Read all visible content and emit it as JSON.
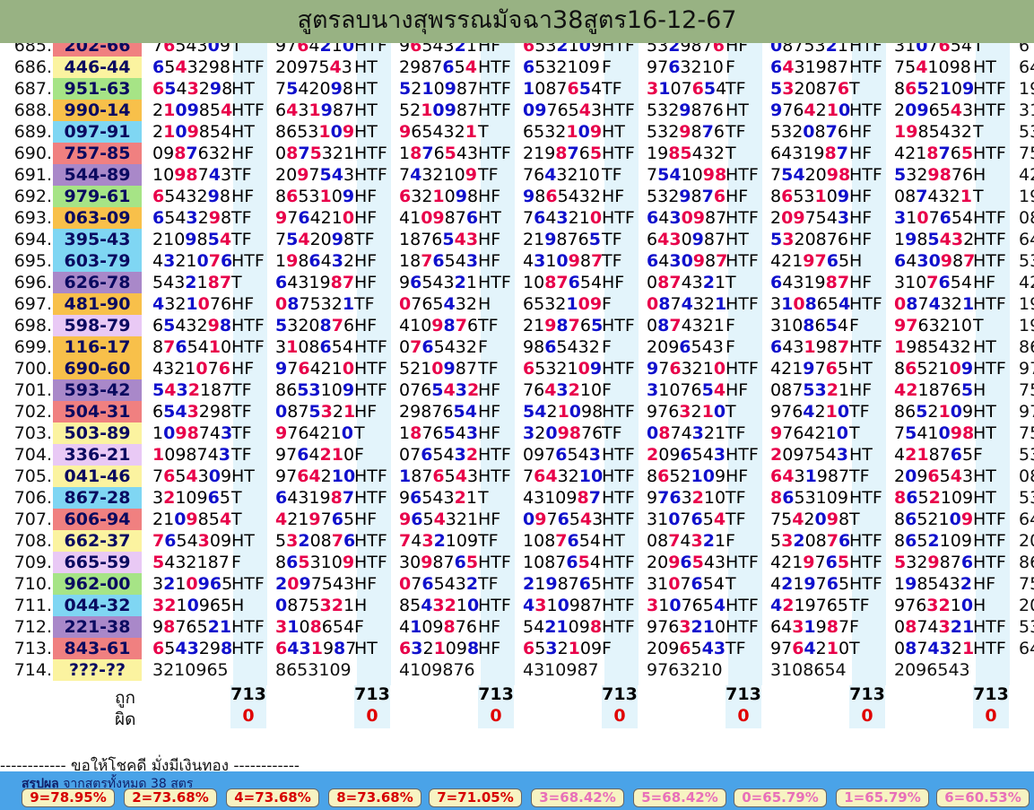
{
  "title": "สูตรลบนางสุพรรณมัจฉา38สูตร16-12-67",
  "colors": {
    "header_bg": "#98b283",
    "cell_bg": "#e3f4fb",
    "digit_blue": "#1010cc",
    "digit_red": "#e8004a",
    "summary_bg": "#4aa3e8",
    "pill_bg": "#f7f3c2",
    "result_colors": [
      "#f08080",
      "#fbf3a0",
      "#a6e486",
      "#f8c04a",
      "#7fd6f3",
      "#a988c9",
      "#e9c9f5"
    ]
  },
  "rows": [
    {
      "n": "685.",
      "r": "202-66",
      "c": 0,
      "cols": [
        [
          "7654309",
          "T"
        ],
        [
          "9764210",
          "HTF"
        ],
        [
          "9654321",
          "HF"
        ],
        [
          "6532109",
          "HTF"
        ],
        [
          "5329876",
          "HF"
        ],
        [
          "0875321",
          "HTF"
        ],
        [
          "3107654",
          "T"
        ],
        [
          "6"
        ]
      ]
    },
    {
      "n": "686.",
      "r": "446-44",
      "c": 1,
      "cols": [
        [
          "6543298",
          "HTF"
        ],
        [
          "2097543",
          "HT"
        ],
        [
          "2987654",
          "HTF"
        ],
        [
          "6532109",
          "F"
        ],
        [
          "9763210",
          "F"
        ],
        [
          "6431987",
          "HTF"
        ],
        [
          "7541098",
          "HT"
        ],
        [
          "64"
        ]
      ]
    },
    {
      "n": "687.",
      "r": "951-63",
      "c": 2,
      "cols": [
        [
          "6543298",
          "HT"
        ],
        [
          "7542098",
          "HT"
        ],
        [
          "5210987",
          "HTF"
        ],
        [
          "1087654",
          "TF"
        ],
        [
          "3107654",
          "TF"
        ],
        [
          "5320876",
          "T"
        ],
        [
          "8652109",
          "HTF"
        ],
        [
          "19"
        ]
      ]
    },
    {
      "n": "688.",
      "r": "990-14",
      "c": 3,
      "cols": [
        [
          "2109854",
          "HTF"
        ],
        [
          "6431987",
          "HT"
        ],
        [
          "5210987",
          "HTF"
        ],
        [
          "0976543",
          "HTF"
        ],
        [
          "5329876",
          "HT"
        ],
        [
          "9764210",
          "HTF"
        ],
        [
          "2096543",
          "HTF"
        ],
        [
          "31"
        ]
      ]
    },
    {
      "n": "689.",
      "r": "097-91",
      "c": 4,
      "cols": [
        [
          "2109854",
          "HT"
        ],
        [
          "8653109",
          "HT"
        ],
        [
          "9654321",
          "T"
        ],
        [
          "6532109",
          "HT"
        ],
        [
          "5329876",
          "TF"
        ],
        [
          "5320876",
          "HF"
        ],
        [
          "1985432",
          "T"
        ],
        [
          "53"
        ]
      ]
    },
    {
      "n": "690.",
      "r": "757-85",
      "c": 0,
      "cols": [
        [
          "0987632",
          "HF"
        ],
        [
          "0875321",
          "HTF"
        ],
        [
          "1876543",
          "HTF"
        ],
        [
          "2198765",
          "HTF"
        ],
        [
          "1985432",
          "T"
        ],
        [
          "6431987",
          "HF"
        ],
        [
          "4218765",
          "HTF"
        ],
        [
          "75"
        ]
      ]
    },
    {
      "n": "691.",
      "r": "544-89",
      "c": 5,
      "cols": [
        [
          "1098743",
          "TF"
        ],
        [
          "2097543",
          "HTF"
        ],
        [
          "7432109",
          "TF"
        ],
        [
          "7643210",
          "TF"
        ],
        [
          "7541098",
          "HTF"
        ],
        [
          "7542098",
          "HTF"
        ],
        [
          "5329876",
          "H"
        ],
        [
          "42"
        ]
      ]
    },
    {
      "n": "692.",
      "r": "979-61",
      "c": 2,
      "cols": [
        [
          "6543298",
          "HF"
        ],
        [
          "8653109",
          "HF"
        ],
        [
          "6321098",
          "HF"
        ],
        [
          "9865432",
          "HF"
        ],
        [
          "5329876",
          "HF"
        ],
        [
          "8653109",
          "HF"
        ],
        [
          "0874321",
          "T"
        ],
        [
          "19"
        ]
      ]
    },
    {
      "n": "693.",
      "r": "063-09",
      "c": 3,
      "cols": [
        [
          "6543298",
          "TF"
        ],
        [
          "9764210",
          "HF"
        ],
        [
          "4109876",
          "HT"
        ],
        [
          "7643210",
          "HTF"
        ],
        [
          "6430987",
          "HTF"
        ],
        [
          "2097543",
          "HF"
        ],
        [
          "3107654",
          "HTF"
        ],
        [
          "08"
        ]
      ]
    },
    {
      "n": "694.",
      "r": "395-43",
      "c": 4,
      "cols": [
        [
          "2109854",
          "TF"
        ],
        [
          "7542098",
          "TF"
        ],
        [
          "1876543",
          "HF"
        ],
        [
          "2198765",
          "TF"
        ],
        [
          "6430987",
          "HT"
        ],
        [
          "5320876",
          "HF"
        ],
        [
          "1985432",
          "HTF"
        ],
        [
          "64"
        ]
      ]
    },
    {
      "n": "695.",
      "r": "603-79",
      "c": 4,
      "cols": [
        [
          "4321076",
          "HTF"
        ],
        [
          "1986432",
          "HF"
        ],
        [
          "1876543",
          "HF"
        ],
        [
          "4310987",
          "TF"
        ],
        [
          "6430987",
          "HTF"
        ],
        [
          "4219765",
          "H"
        ],
        [
          "6430987",
          "HTF"
        ],
        [
          "53"
        ]
      ]
    },
    {
      "n": "696.",
      "r": "626-78",
      "c": 5,
      "cols": [
        [
          "5432187",
          "T"
        ],
        [
          "6431987",
          "HF"
        ],
        [
          "9654321",
          "HTF"
        ],
        [
          "1087654",
          "HF"
        ],
        [
          "0874321",
          "T"
        ],
        [
          "6431987",
          "HF"
        ],
        [
          "3107654",
          "HF"
        ],
        [
          "42"
        ]
      ]
    },
    {
      "n": "697.",
      "r": "481-90",
      "c": 3,
      "cols": [
        [
          "4321076",
          "HF"
        ],
        [
          "0875321",
          "TF"
        ],
        [
          "0765432",
          "H"
        ],
        [
          "6532109",
          "F"
        ],
        [
          "0874321",
          "HTF"
        ],
        [
          "3108654",
          "HTF"
        ],
        [
          "0874321",
          "HTF"
        ],
        [
          "19"
        ]
      ]
    },
    {
      "n": "698.",
      "r": "598-79",
      "c": 6,
      "cols": [
        [
          "6543298",
          "HTF"
        ],
        [
          "5320876",
          "HF"
        ],
        [
          "4109876",
          "TF"
        ],
        [
          "2198765",
          "HTF"
        ],
        [
          "0874321",
          "F"
        ],
        [
          "3108654",
          "F"
        ],
        [
          "9763210",
          "T"
        ],
        [
          "19"
        ]
      ]
    },
    {
      "n": "699.",
      "r": "116-17",
      "c": 3,
      "cols": [
        [
          "8765410",
          "HTF"
        ],
        [
          "3108654",
          "HTF"
        ],
        [
          "0765432",
          "F"
        ],
        [
          "9865432",
          "F"
        ],
        [
          "2096543",
          "F"
        ],
        [
          "6431987",
          "HTF"
        ],
        [
          "1985432",
          "HT"
        ],
        [
          "86"
        ]
      ]
    },
    {
      "n": "700.",
      "r": "690-60",
      "c": 3,
      "cols": [
        [
          "4321076",
          "HF"
        ],
        [
          "9764210",
          "HTF"
        ],
        [
          "5210987",
          "TF"
        ],
        [
          "6532109",
          "HTF"
        ],
        [
          "9763210",
          "HTF"
        ],
        [
          "4219765",
          "HT"
        ],
        [
          "8652109",
          "HTF"
        ],
        [
          "97"
        ]
      ]
    },
    {
      "n": "701.",
      "r": "593-42",
      "c": 5,
      "cols": [
        [
          "5432187",
          "TF"
        ],
        [
          "8653109",
          "HTF"
        ],
        [
          "0765432",
          "HF"
        ],
        [
          "7643210",
          "F"
        ],
        [
          "3107654",
          "HF"
        ],
        [
          "0875321",
          "HF"
        ],
        [
          "4218765",
          "H"
        ],
        [
          "75"
        ]
      ]
    },
    {
      "n": "702.",
      "r": "504-31",
      "c": 0,
      "cols": [
        [
          "6543298",
          "TF"
        ],
        [
          "0875321",
          "HF"
        ],
        [
          "2987654",
          "HF"
        ],
        [
          "5421098",
          "HTF"
        ],
        [
          "9763210",
          "T"
        ],
        [
          "9764210",
          "TF"
        ],
        [
          "8652109",
          "HT"
        ],
        [
          "97"
        ]
      ]
    },
    {
      "n": "703.",
      "r": "503-89",
      "c": 1,
      "cols": [
        [
          "1098743",
          "TF"
        ],
        [
          "9764210",
          "T"
        ],
        [
          "1876543",
          "HF"
        ],
        [
          "3209876",
          "TF"
        ],
        [
          "0874321",
          "TF"
        ],
        [
          "9764210",
          "T"
        ],
        [
          "7541098",
          "HT"
        ],
        [
          "75"
        ]
      ]
    },
    {
      "n": "704.",
      "r": "336-21",
      "c": 6,
      "cols": [
        [
          "1098743",
          "TF"
        ],
        [
          "9764210",
          "F"
        ],
        [
          "0765432",
          "HTF"
        ],
        [
          "0976543",
          "HTF"
        ],
        [
          "2096543",
          "HTF"
        ],
        [
          "2097543",
          "HT"
        ],
        [
          "4218765",
          "F"
        ],
        [
          "53"
        ]
      ]
    },
    {
      "n": "705.",
      "r": "041-46",
      "c": 1,
      "cols": [
        [
          "7654309",
          "HT"
        ],
        [
          "9764210",
          "HTF"
        ],
        [
          "1876543",
          "HTF"
        ],
        [
          "7643210",
          "HTF"
        ],
        [
          "8652109",
          "HF"
        ],
        [
          "6431987",
          "TF"
        ],
        [
          "2096543",
          "HT"
        ],
        [
          "08"
        ]
      ]
    },
    {
      "n": "706.",
      "r": "867-28",
      "c": 4,
      "cols": [
        [
          "3210965",
          "T"
        ],
        [
          "6431987",
          "HTF"
        ],
        [
          "9654321",
          "T"
        ],
        [
          "4310987",
          "HTF"
        ],
        [
          "9763210",
          "TF"
        ],
        [
          "8653109",
          "HTF"
        ],
        [
          "8652109",
          "HT"
        ],
        [
          "53"
        ]
      ]
    },
    {
      "n": "707.",
      "r": "606-94",
      "c": 0,
      "cols": [
        [
          "2109854",
          "T"
        ],
        [
          "4219765",
          "HF"
        ],
        [
          "9654321",
          "HF"
        ],
        [
          "0976543",
          "HTF"
        ],
        [
          "3107654",
          "TF"
        ],
        [
          "7542098",
          "T"
        ],
        [
          "8652109",
          "HTF"
        ],
        [
          "64"
        ]
      ]
    },
    {
      "n": "708.",
      "r": "662-37",
      "c": 1,
      "cols": [
        [
          "7654309",
          "HT"
        ],
        [
          "5320876",
          "HTF"
        ],
        [
          "7432109",
          "TF"
        ],
        [
          "1087654",
          "HT"
        ],
        [
          "0874321",
          "F"
        ],
        [
          "5320876",
          "HTF"
        ],
        [
          "8652109",
          "HTF"
        ],
        [
          "20"
        ]
      ]
    },
    {
      "n": "709.",
      "r": "665-59",
      "c": 6,
      "cols": [
        [
          "5432187",
          "F"
        ],
        [
          "8653109",
          "HTF"
        ],
        [
          "3098765",
          "HTF"
        ],
        [
          "1087654",
          "HTF"
        ],
        [
          "2096543",
          "HTF"
        ],
        [
          "4219765",
          "HTF"
        ],
        [
          "5329876",
          "HTF"
        ],
        [
          "86"
        ]
      ]
    },
    {
      "n": "710.",
      "r": "962-00",
      "c": 2,
      "cols": [
        [
          "3210965",
          "HTF"
        ],
        [
          "2097543",
          "HF"
        ],
        [
          "0765432",
          "TF"
        ],
        [
          "2198765",
          "HTF"
        ],
        [
          "3107654",
          "T"
        ],
        [
          "4219765",
          "HTF"
        ],
        [
          "1985432",
          "HF"
        ],
        [
          "75"
        ]
      ]
    },
    {
      "n": "711.",
      "r": "044-32",
      "c": 4,
      "cols": [
        [
          "3210965",
          "H"
        ],
        [
          "0875321",
          "H"
        ],
        [
          "8543210",
          "HTF"
        ],
        [
          "4310987",
          "HTF"
        ],
        [
          "3107654",
          "HTF"
        ],
        [
          "4219765",
          "TF"
        ],
        [
          "9763210",
          "H"
        ],
        [
          "20"
        ]
      ]
    },
    {
      "n": "712.",
      "r": "221-38",
      "c": 5,
      "cols": [
        [
          "9876521",
          "HTF"
        ],
        [
          "3108654",
          "F"
        ],
        [
          "4109876",
          "HF"
        ],
        [
          "5421098",
          "HTF"
        ],
        [
          "9763210",
          "HTF"
        ],
        [
          "6431987",
          "F"
        ],
        [
          "0874321",
          "HTF"
        ],
        [
          "53"
        ]
      ]
    },
    {
      "n": "713.",
      "r": "843-61",
      "c": 0,
      "cols": [
        [
          "6543298",
          "HTF"
        ],
        [
          "6431987",
          "HT"
        ],
        [
          "6321098",
          "HF"
        ],
        [
          "6532109",
          "F"
        ],
        [
          "2096543",
          "TF"
        ],
        [
          "9764210",
          "T"
        ],
        [
          "0874321",
          "HTF"
        ],
        [
          "64"
        ]
      ]
    },
    {
      "n": "714.",
      "r": "???-??",
      "c": 1,
      "cols": [
        [
          "3210965",
          ""
        ],
        [
          "8653109",
          ""
        ],
        [
          "4109876",
          ""
        ],
        [
          "4310987",
          ""
        ],
        [
          "9763210",
          ""
        ],
        [
          "3108654",
          ""
        ],
        [
          "2096543",
          ""
        ],
        [
          ""
        ]
      ]
    }
  ],
  "footer": {
    "right_label": "ถูก",
    "wrong_label": "ผิด",
    "right_counts": [
      "713",
      "713",
      "713",
      "713",
      "713",
      "713",
      "713"
    ],
    "wrong_counts": [
      "0",
      "0",
      "0",
      "0",
      "0",
      "0",
      "0"
    ]
  },
  "luck_text": "------------ ขอให้โชคดี มั่งมีเงินทอง ------------",
  "summary": {
    "label_bold": "สรุปผล",
    "label_rest": "จากสูตรทั้งหมด 38 สูตร",
    "pills": [
      {
        "text": "9=78.95%",
        "color": "#d60000"
      },
      {
        "text": "2=73.68%",
        "color": "#d60000"
      },
      {
        "text": "4=73.68%",
        "color": "#d60000"
      },
      {
        "text": "8=73.68%",
        "color": "#d60000"
      },
      {
        "text": "7=71.05%",
        "color": "#d60000"
      },
      {
        "text": "3=68.42%",
        "color": "#e870b8"
      },
      {
        "text": "5=68.42%",
        "color": "#e870b8"
      },
      {
        "text": "0=65.79%",
        "color": "#e870b8"
      },
      {
        "text": "1=65.79%",
        "color": "#e870b8"
      },
      {
        "text": "6=60.53%",
        "color": "#e870b8"
      }
    ]
  }
}
